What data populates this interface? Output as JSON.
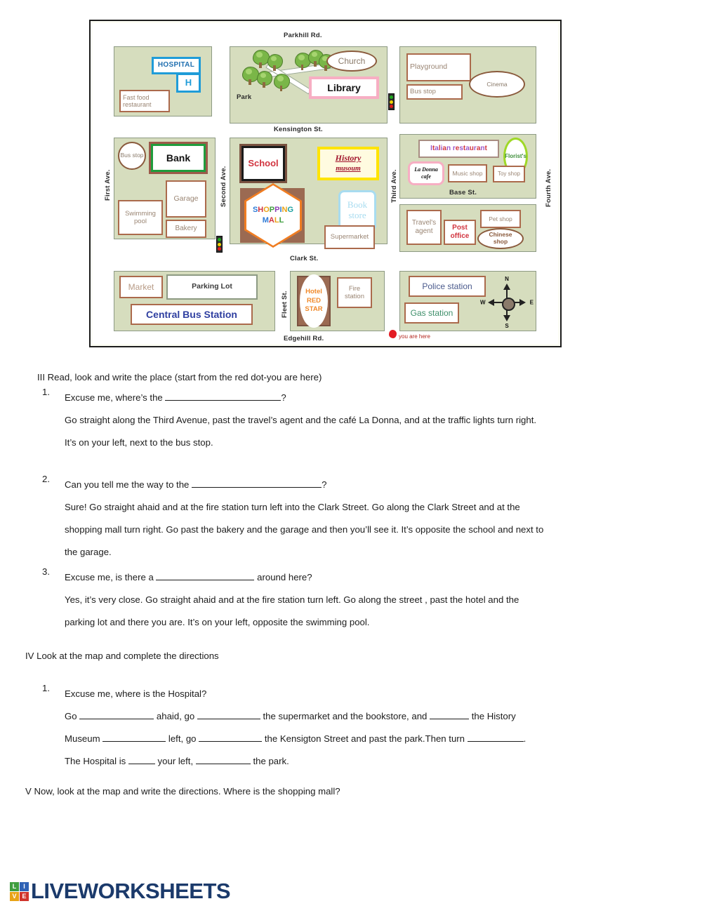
{
  "map": {
    "streets": {
      "parkhill": "Parkhill Rd.",
      "kensington": "Kensington St.",
      "base": "Base St.",
      "clark": "Clark St.",
      "edgehill": "Edgehill Rd.",
      "first_ave": "First Ave.",
      "second_ave": "Second Ave.",
      "third_ave": "Third Ave.",
      "fourth_ave": "Fourth Ave.",
      "fleet": "Fleet St."
    },
    "places": {
      "hospital": "HOSPITAL",
      "hospital_h": "H",
      "fast_food": "Fast food restaurant",
      "park": "Park",
      "church": "Church",
      "library": "Library",
      "playground": "Playground",
      "bus_stop_top": "Bus stop",
      "cinema": "Cinema",
      "bus_stop_left": "Bus stop",
      "bank": "Bank",
      "garage": "Garage",
      "swimming_pool": "Swimming pool",
      "bakery": "Bakery",
      "school": "School",
      "history_museum_line1": "History",
      "history_museum_line2": "musoum",
      "shopping_mall_line1": "SHOPPING",
      "shopping_mall_line2": "MALL",
      "book_store_line1": "Book",
      "book_store_line2": "store",
      "supermarket": "Supermarket",
      "italian_restaurant": "Italian restaurant",
      "florist": "Florist's",
      "la_donna_line1": "La Donna",
      "la_donna_line2": "cafe",
      "music_shop": "Music shop",
      "toy_shop": "Toy shop",
      "travels_agent": "Travel's agent",
      "post_office_line1": "Post",
      "post_office_line2": "office",
      "pet_shop": "Pet shop",
      "chinese_shop_line1": "Chinese",
      "chinese_shop_line2": "shop",
      "market": "Market",
      "parking_lot": "Parking Lot",
      "central_bus_station": "Central Bus Station",
      "hotel_line1": "Hotel",
      "hotel_line2": "RED",
      "hotel_line3": "STAR",
      "fire_station": "Fire station",
      "police_station": "Police station",
      "gas_station": "Gas station"
    },
    "compass": {
      "n": "N",
      "s": "S",
      "e": "E",
      "w": "W"
    },
    "you_are_here": "you are here",
    "mall_letter_colors": [
      "#2f7bd6",
      "#d1343f",
      "#e8a317",
      "#3f9e3f",
      "#8b3fb5",
      "#2f7bd6",
      "#e8a317",
      "#1aa0a0"
    ],
    "italian_letter_colors": [
      "#9b59c9",
      "#d1343f"
    ],
    "colors": {
      "block_fill": "#d6ddbe",
      "block_stroke": "#8d9a84",
      "building_stroke": "#ab6a4c",
      "hospital_blue": "#1f9cd8",
      "library_pink": "#f7aec3",
      "bank_green": "#1f9d3d",
      "museum_yellow": "#ffe400",
      "bookstore_blue": "#a8dcf0",
      "mall_orange": "#f07d22",
      "florist_green": "#9fd827",
      "red_dot": "#e31b23"
    }
  },
  "sections": {
    "three": {
      "heading": "III Read, look and write the place (start from the red dot-you are here)",
      "items": [
        {
          "number": "1.",
          "q_pre": "Excuse me, where’s the ",
          "q_post": "?",
          "lines": [
            "Go straight along the Third Avenue, past the travel’s agent and the café La Donna, and at the traffic lights turn right.",
            "It’s on your left, next to the bus stop."
          ]
        },
        {
          "number": "2.",
          "q_pre": "Can you tell me the way to the  ",
          "q_post": "?",
          "lines": [
            "Sure! Go straight ahaid and at the fire station turn left into the Clark Street. Go along the Clark Street and at the",
            "shopping mall turn right. Go past the bakery and the garage and then you’ll see it. It’s opposite the school and next to",
            "the garage."
          ]
        },
        {
          "number": "3.",
          "q_pre": "Excuse me, is there a ",
          "q_post": " around here?",
          "lines": [
            "Yes, it’s very close. Go straight ahaid and at the fire station turn left. Go along the street , past the hotel and the",
            "parking lot and there you are. It’s on your left, opposite the swimming pool."
          ]
        }
      ]
    },
    "four": {
      "heading": "IV Look at the map and complete the directions",
      "number": "1.",
      "question": "Excuse me, where is the  Hospital?",
      "line1_a": "Go ",
      "line1_b": " ahaid, go ",
      "line1_c": " the supermarket and the bookstore, and ",
      "line1_d": " the History",
      "line2_a": "Museum ",
      "line2_b": " left, go ",
      "line2_c": " the Kensigton Street and past the park.Then turn ",
      "line2_d": ".",
      "line3_a": "The Hospital is ",
      "line3_b": " your left, ",
      "line3_c": " the park."
    },
    "five": {
      "heading": "V  Now, look at the map and write the directions. Where is the shopping mall?"
    }
  },
  "footer": {
    "logo_squares": [
      "L",
      "I",
      "V",
      "E"
    ],
    "logo_word": "LIVEWORKSHEETS"
  }
}
